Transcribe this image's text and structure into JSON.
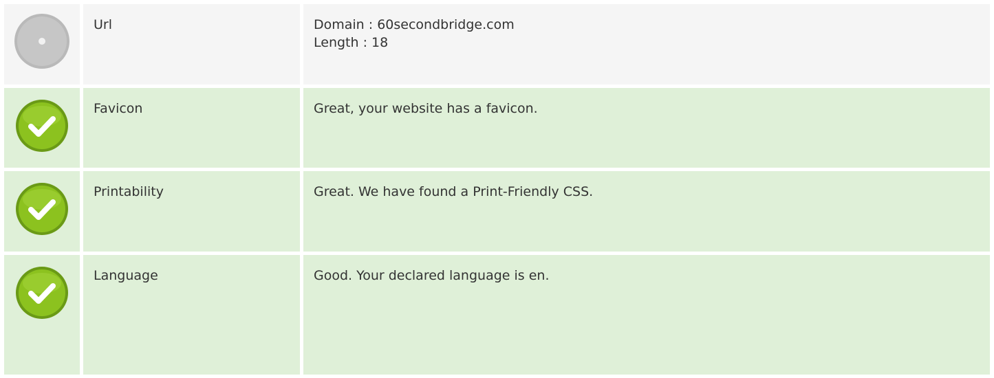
{
  "rows": [
    {
      "status": "neutral",
      "status_icon": "grey-circle-icon",
      "label": "Url",
      "values": [
        "Domain : 60secondbridge.com",
        "Length : 18"
      ]
    },
    {
      "status": "pass",
      "status_icon": "green-check-icon",
      "label": "Favicon",
      "values": [
        "Great, your website has a favicon."
      ]
    },
    {
      "status": "pass",
      "status_icon": "green-check-icon",
      "label": "Printability",
      "values": [
        "Great. We have found a Print-Friendly CSS."
      ]
    },
    {
      "status": "pass",
      "status_icon": "green-check-icon",
      "label": "Language",
      "values": [
        "Good. Your declared language is en."
      ]
    }
  ],
  "colors": {
    "neutral_bg": "#f5f5f5",
    "pass_bg": "#dff0d8",
    "check_green": "#8cc21f"
  }
}
